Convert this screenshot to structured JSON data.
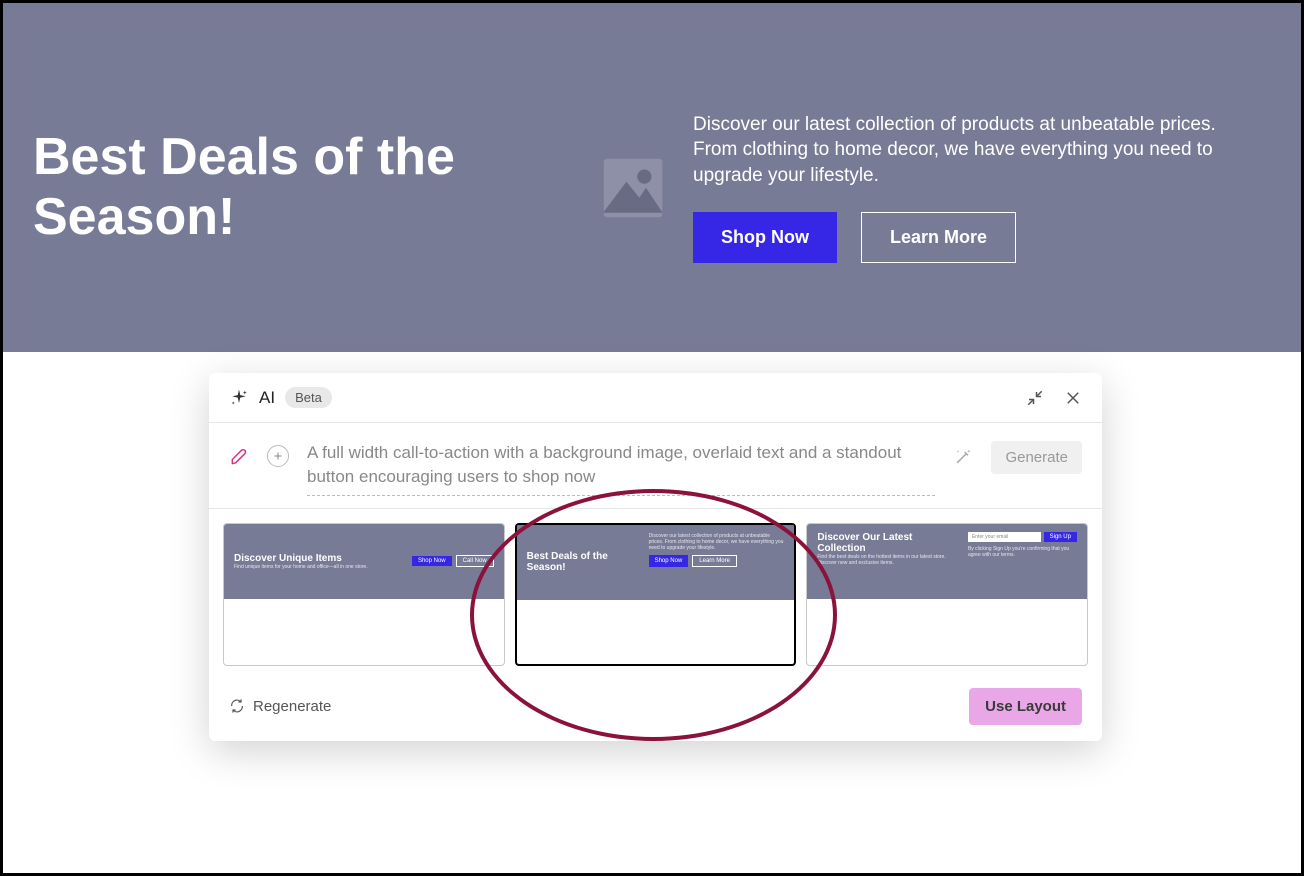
{
  "hero": {
    "title": "Best Deals of the Season!",
    "description": "Discover our latest collection of products at unbeatable prices. From clothing to home decor, we have everything you need to upgrade your lifestyle.",
    "primary_btn": "Shop Now",
    "secondary_btn": "Learn More"
  },
  "modal": {
    "ai_label": "AI",
    "beta_label": "Beta",
    "prompt_text": "A full width call-to-action with a background image, overlaid text and a standout button encouraging users to shop now",
    "generate_btn": "Generate",
    "regenerate_label": "Regenerate",
    "use_layout_btn": "Use Layout"
  },
  "previews": [
    {
      "title": "Discover Unique Items",
      "sub": "Find unique items for your home and office—all in one store.",
      "btn1": "Shop Now",
      "btn2": "Call Now",
      "selected": false
    },
    {
      "title": "Best Deals of the Season!",
      "sub": "Discover our latest collection of products at unbeatable prices. From clothing to home decor, we have everything you need to upgrade your lifestyle.",
      "btn1": "Shop Now",
      "btn2": "Learn More",
      "selected": true
    },
    {
      "title": "Discover Our Latest Collection",
      "sub": "Find the best deals on the hottest items in our latest store. Discover new and exclusive items.",
      "sub2": "By clicking Sign Up you're confirming that you agree with our terms.",
      "input_placeholder": "Enter your email",
      "btn1": "Sign Up",
      "selected": false
    }
  ]
}
